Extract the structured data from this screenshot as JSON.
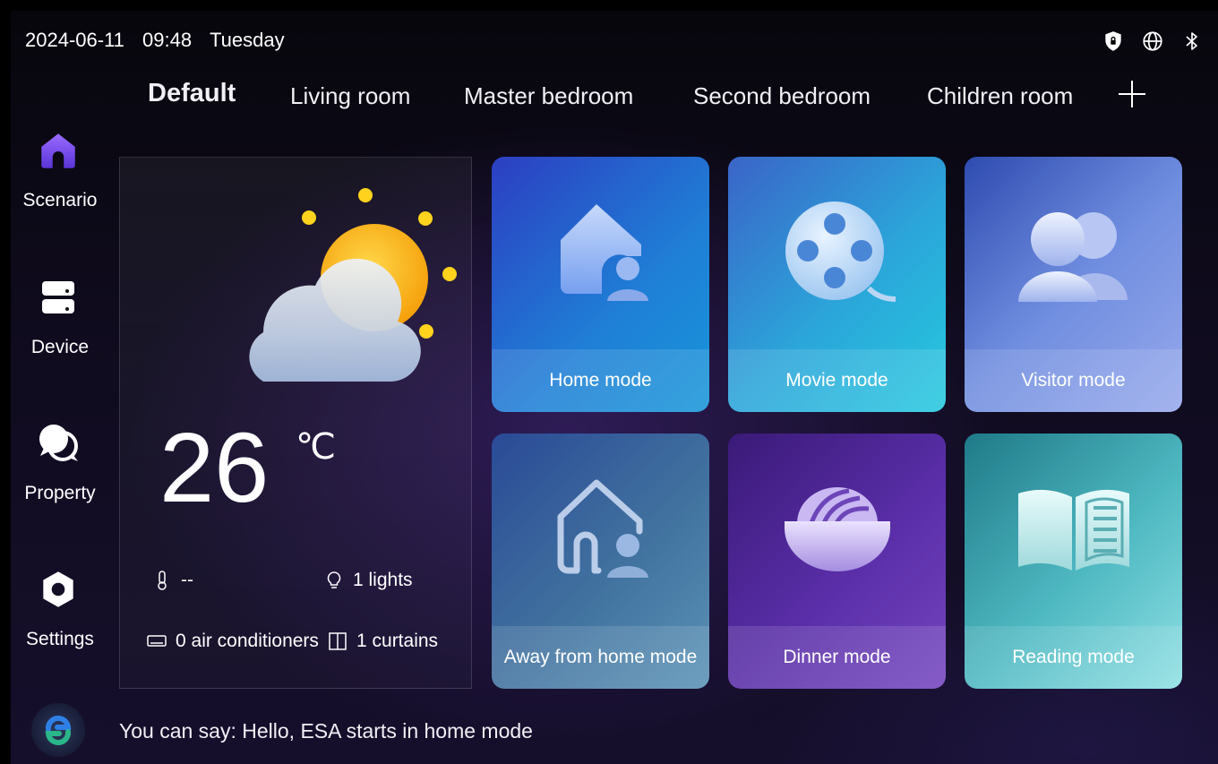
{
  "status_bar": {
    "date": "2024-06-11",
    "time": "09:48",
    "weekday": "Tuesday",
    "icons": [
      "shield-lock-icon",
      "globe-icon",
      "bluetooth-icon"
    ]
  },
  "sidebar": {
    "items": [
      {
        "label": "Scenario",
        "icon": "home-icon",
        "active": true
      },
      {
        "label": "Device",
        "icon": "device-icon",
        "active": false
      },
      {
        "label": "Property",
        "icon": "chat-icon",
        "active": false
      },
      {
        "label": "Settings",
        "icon": "gear-icon",
        "active": false
      }
    ]
  },
  "tabs": {
    "items": [
      {
        "label": "Default",
        "active": true
      },
      {
        "label": "Living room",
        "active": false
      },
      {
        "label": "Master bedroom",
        "active": false
      },
      {
        "label": "Second bedroom",
        "active": false
      },
      {
        "label": "Children room",
        "active": false
      }
    ],
    "add_icon": "plus-icon"
  },
  "weather": {
    "condition_icon": "partly-cloudy-icon",
    "temperature": "26",
    "unit": "℃",
    "humidity": "--",
    "lights": "1 lights",
    "air_conditioners": "0 air conditioners",
    "curtains": "1 curtains"
  },
  "modes": [
    {
      "label": "Home mode",
      "icon": "home-person-icon"
    },
    {
      "label": "Movie mode",
      "icon": "film-reel-icon"
    },
    {
      "label": "Visitor mode",
      "icon": "people-icon"
    },
    {
      "label": "Away from home mode",
      "icon": "home-outline-person-icon"
    },
    {
      "label": "Dinner mode",
      "icon": "noodle-bowl-icon"
    },
    {
      "label": "Reading mode",
      "icon": "open-book-icon"
    }
  ],
  "footer": {
    "assistant_icon": "assistant-logo-icon",
    "hint": "You can say: Hello, ESA starts in home mode"
  },
  "colors": {
    "accent_purple": "#7a4ff0",
    "tile_home": "#1f7fd6",
    "tile_movie": "#2dc4e0",
    "tile_visitor": "#8aa3ee",
    "tile_away": "#4d83b0",
    "tile_dinner": "#6a3ab8",
    "tile_reading": "#6fd8dd"
  }
}
